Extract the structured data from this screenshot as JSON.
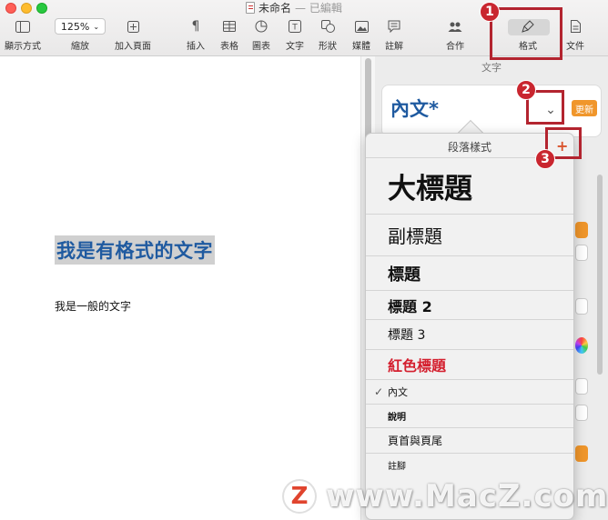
{
  "window": {
    "title": "未命名",
    "status": "已編輯"
  },
  "toolbar": {
    "view_label": "顯示方式",
    "zoom_value": "125%",
    "zoom_label": "縮放",
    "add_page_label": "加入頁面",
    "insert_label": "插入",
    "table_label": "表格",
    "chart_label": "圖表",
    "text_label": "文字",
    "shape_label": "形狀",
    "media_label": "媒體",
    "comment_label": "註解",
    "collaborate_label": "合作",
    "format_label": "格式",
    "document_label": "文件"
  },
  "document": {
    "heading_text": "我是有格式的文字",
    "body_text": "我是一般的文字"
  },
  "inspector": {
    "tab_title": "文字",
    "current_style": "內文*",
    "update_label": "更新"
  },
  "popover": {
    "title": "段落樣式",
    "styles": [
      {
        "label": "大標題",
        "checked": false
      },
      {
        "label": "副標題",
        "checked": false
      },
      {
        "label": "標題",
        "checked": false
      },
      {
        "label": "標題 2",
        "checked": false
      },
      {
        "label": "標題 3",
        "checked": false
      },
      {
        "label": "紅色標題",
        "checked": false
      },
      {
        "label": "內文",
        "checked": true
      },
      {
        "label": "說明",
        "checked": false
      },
      {
        "label": "頁首與頁尾",
        "checked": false
      },
      {
        "label": "註腳",
        "checked": false
      }
    ]
  },
  "annotations": [
    "1",
    "2",
    "3"
  ],
  "watermark": {
    "logo": "Z",
    "text": "www.MacZ.com"
  },
  "colors": {
    "heading_blue": "#1f5aa0",
    "red_style": "#d4202f",
    "annotation_red": "#c9262f",
    "update_orange": "#f0962b"
  }
}
